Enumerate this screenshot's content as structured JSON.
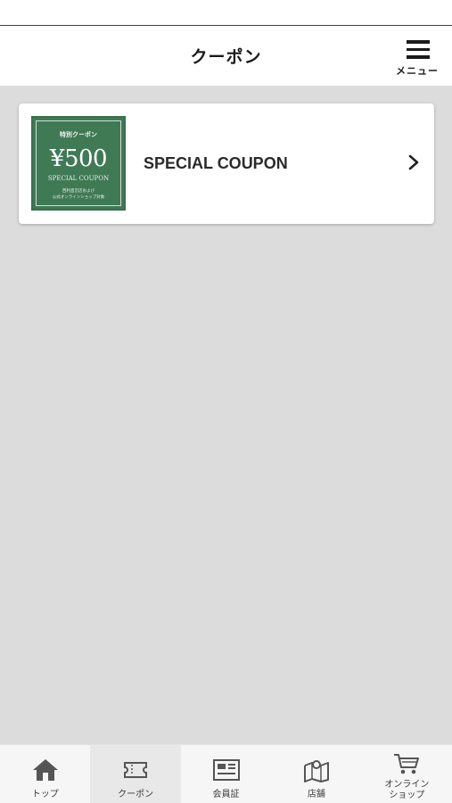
{
  "header": {
    "title": "クーポン",
    "menu_label": "メニュー"
  },
  "coupon": {
    "thumb_top_text": "特別クーポン",
    "thumb_price": "¥500",
    "thumb_special": "SPECIAL COUPON",
    "thumb_note_line1": "西利直営店および",
    "thumb_note_line2": "公式オンラインショップ対象",
    "title": "SPECIAL COUPON",
    "thumb_color": "#3f7a55"
  },
  "tabbar": {
    "items": [
      {
        "label": "トップ",
        "icon": "home-icon",
        "active": false
      },
      {
        "label": "クーポン",
        "icon": "ticket-icon",
        "active": true
      },
      {
        "label": "会員証",
        "icon": "member-card-icon",
        "active": false
      },
      {
        "label": "店舗",
        "icon": "map-icon",
        "active": false
      },
      {
        "label_line1": "オンライン",
        "label_line2": "ショップ",
        "icon": "cart-icon",
        "active": false
      }
    ]
  }
}
